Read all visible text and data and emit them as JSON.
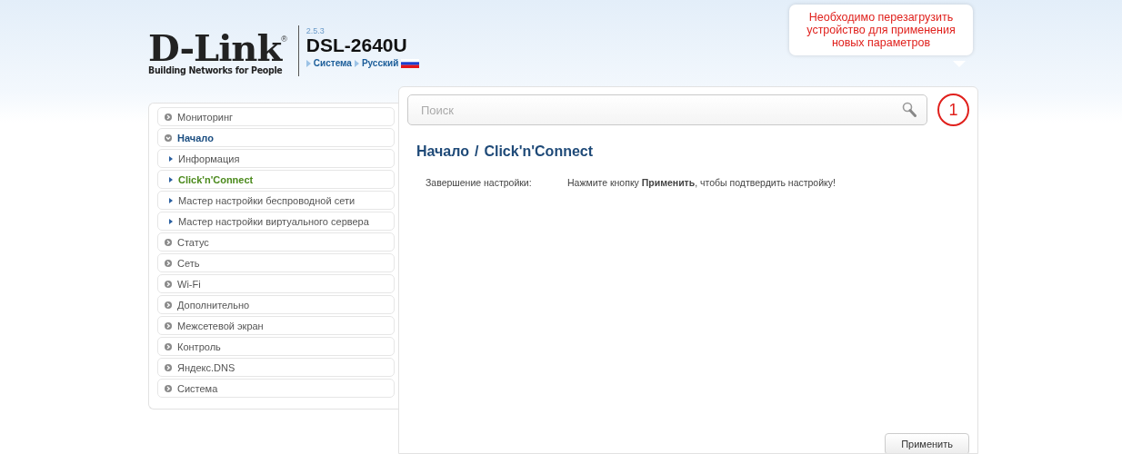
{
  "header": {
    "logo": "D-Link",
    "registered": "®",
    "tagline": "Building Networks for People",
    "version": "2.5.3",
    "model": "DSL-2640U",
    "breadcrumbs": [
      "Система",
      "Русский"
    ]
  },
  "notification": {
    "message": "Необходимо перезагрузить устройство для применения новых параметров",
    "count": "1"
  },
  "menu": [
    {
      "label": "Мониторинг",
      "expanded": false,
      "selected": false
    },
    {
      "label": "Начало",
      "expanded": true,
      "selected": true,
      "children": [
        {
          "label": "Информация",
          "selected": false
        },
        {
          "label": "Click'n'Connect",
          "selected": true
        },
        {
          "label": "Мастер настройки беспроводной сети",
          "selected": false
        },
        {
          "label": "Мастер настройки виртуального сервера",
          "selected": false
        }
      ]
    },
    {
      "label": "Статус",
      "expanded": false,
      "selected": false
    },
    {
      "label": "Сеть",
      "expanded": false,
      "selected": false
    },
    {
      "label": "Wi-Fi",
      "expanded": false,
      "selected": false
    },
    {
      "label": "Дополнительно",
      "expanded": false,
      "selected": false
    },
    {
      "label": "Межсетевой экран",
      "expanded": false,
      "selected": false
    },
    {
      "label": "Контроль",
      "expanded": false,
      "selected": false
    },
    {
      "label": "Яндекс.DNS",
      "expanded": false,
      "selected": false
    },
    {
      "label": "Система",
      "expanded": false,
      "selected": false
    }
  ],
  "search": {
    "placeholder": "Поиск"
  },
  "page": {
    "breadcrumb": [
      "Начало",
      "Click'n'Connect"
    ],
    "separator": "/",
    "fields": [
      {
        "label": "Завершение настройки:",
        "value": "Нажмите кнопку **Применить**, чтобы подтвердить настройку!"
      }
    ]
  },
  "buttons": [
    "Применить"
  ]
}
